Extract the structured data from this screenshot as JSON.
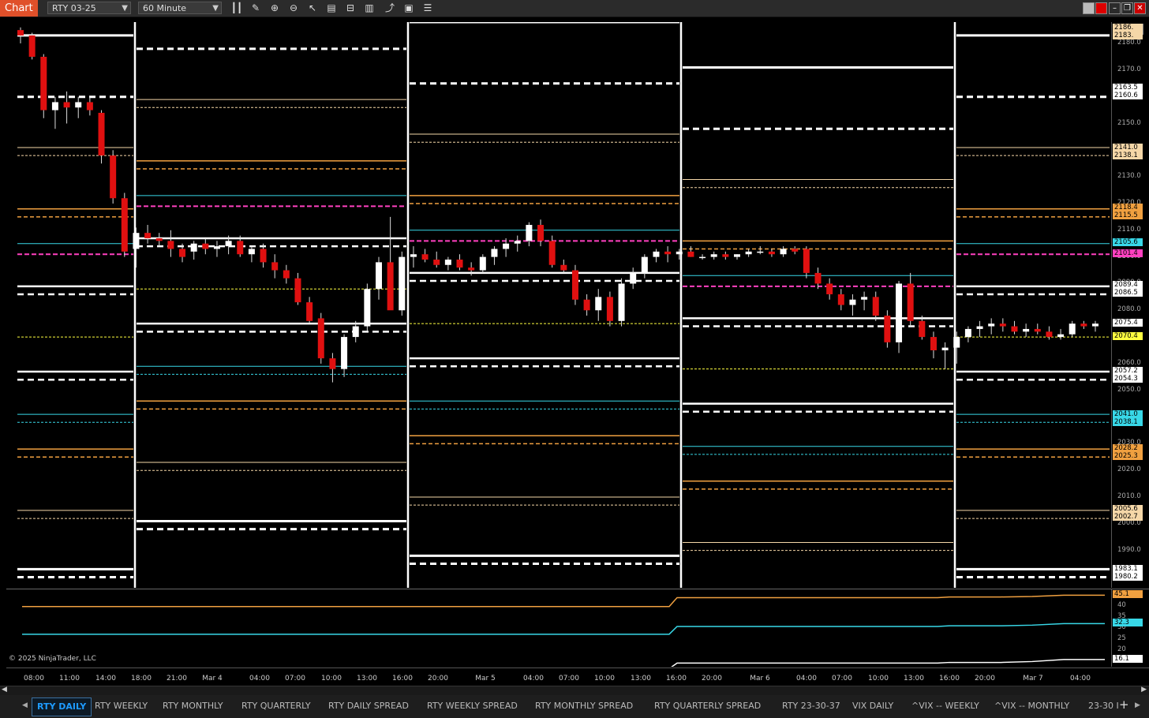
{
  "toolbar": {
    "chart_label": "Chart",
    "instrument": "RTY 03-25",
    "interval": "60 Minute"
  },
  "copyright": "© 2025 NinjaTrader, LLC",
  "price_ticks": [
    "2180.0",
    "2170.0",
    "2160.0",
    "2150.0",
    "2140.0",
    "2130.0",
    "2120.0",
    "2110.0",
    "2100.0",
    "2090.0",
    "2080.0",
    "2070.0",
    "2060.0",
    "2050.0",
    "2040.0",
    "2030.0",
    "2020.0",
    "2010.0",
    "2000.0",
    "1990.0",
    "1980.0"
  ],
  "price_tags": [
    {
      "label": "2186.",
      "color": "#f5d7a8",
      "price": 2186
    },
    {
      "label": "2183.",
      "color": "#f5d7a8",
      "price": 2183
    },
    {
      "label": "2163.5",
      "color": "#ffffff",
      "price": 2163.5
    },
    {
      "label": "2160.6",
      "color": "#ffffff",
      "price": 2160.6
    },
    {
      "label": "2141.0",
      "color": "#f5d7a8",
      "price": 2141
    },
    {
      "label": "2138.1",
      "color": "#f5d7a8",
      "price": 2138.1
    },
    {
      "label": "2118.4",
      "color": "#f0a040",
      "price": 2118.4
    },
    {
      "label": "2115.5",
      "color": "#f0a040",
      "price": 2115.5
    },
    {
      "label": "2105.6",
      "color": "#38d8e8",
      "price": 2105.6
    },
    {
      "label": "2101.4",
      "color": "#ff40c0",
      "price": 2101.4
    },
    {
      "label": "2089.4",
      "color": "#ffffff",
      "price": 2089.4
    },
    {
      "label": "2086.5",
      "color": "#ffffff",
      "price": 2086.5
    },
    {
      "label": "2075.4",
      "color": "#ffffff",
      "price": 2075.4
    },
    {
      "label": "2070.4",
      "color": "#ffff40",
      "price": 2070.4
    },
    {
      "label": "2057.2",
      "color": "#ffffff",
      "price": 2057.2
    },
    {
      "label": "2054.3",
      "color": "#ffffff",
      "price": 2054.3
    },
    {
      "label": "2041.0",
      "color": "#38d8e8",
      "price": 2041
    },
    {
      "label": "2038.1",
      "color": "#38d8e8",
      "price": 2038.1
    },
    {
      "label": "2028.2",
      "color": "#f0a040",
      "price": 2028.2
    },
    {
      "label": "2025.3",
      "color": "#f0a040",
      "price": 2025.3
    },
    {
      "label": "2005.6",
      "color": "#f5d7a8",
      "price": 2005.6
    },
    {
      "label": "2002.7",
      "color": "#f5d7a8",
      "price": 2002.7
    },
    {
      "label": "1983.1",
      "color": "#ffffff",
      "price": 1983.1
    },
    {
      "label": "1980.2",
      "color": "#ffffff",
      "price": 1980.2
    }
  ],
  "indicator": {
    "ticks": [
      "40",
      "35",
      "30",
      "25",
      "20"
    ],
    "tags": [
      {
        "label": "45.1",
        "color": "#f0a040",
        "value": 45.1
      },
      {
        "label": "32.3",
        "color": "#38d8e8",
        "value": 32.3
      },
      {
        "label": "16.1",
        "color": "#ffffff",
        "value": 16.1
      }
    ]
  },
  "time_ticks": [
    "08:00",
    "11:00",
    "14:00",
    "18:00",
    "21:00",
    "Mar 4",
    "04:00",
    "07:00",
    "10:00",
    "13:00",
    "16:00",
    "20:00",
    "Mar 5",
    "04:00",
    "07:00",
    "10:00",
    "13:00",
    "16:00",
    "20:00",
    "Mar 6",
    "04:00",
    "07:00",
    "10:00",
    "13:00",
    "16:00",
    "20:00",
    "Mar 7",
    "04:00"
  ],
  "tabs": [
    "RTY DAILY",
    "RTY WEEKLY",
    "RTY MONTHLY",
    "RTY QUARTERLY",
    "RTY DAILY SPREAD",
    "RTY WEEKLY SPREAD",
    "RTY MONTHLY SPREAD",
    "RTY QUARTERLY SPREAD",
    "RTY 23-30-37",
    "VIX DAILY",
    "^VIX -- WEEKLY",
    "^VIX -- MONTHLY",
    "23-30 I"
  ],
  "chart_data": {
    "type": "candlestick",
    "instrument": "RTY 03-25",
    "interval": "60 Minute",
    "ylim": [
      1976,
      2188
    ],
    "candles": [
      [
        2185,
        2186,
        2180,
        2183
      ],
      [
        2183,
        2184,
        2174,
        2175
      ],
      [
        2175,
        2176,
        2152,
        2155
      ],
      [
        2155,
        2160,
        2148,
        2158
      ],
      [
        2158,
        2162,
        2150,
        2156
      ],
      [
        2156,
        2160,
        2152,
        2158
      ],
      [
        2158,
        2160,
        2153,
        2155
      ],
      [
        2154,
        2155,
        2135,
        2138
      ],
      [
        2138,
        2140,
        2120,
        2122
      ],
      [
        2122,
        2124,
        2100,
        2102
      ],
      [
        2103,
        2111,
        2096,
        2109
      ],
      [
        2109,
        2112,
        2105,
        2107
      ],
      [
        2107,
        2109,
        2104,
        2106
      ],
      [
        2106,
        2110,
        2100,
        2103
      ],
      [
        2103,
        2105,
        2098,
        2100
      ],
      [
        2102,
        2106,
        2099,
        2105
      ],
      [
        2105,
        2107,
        2101,
        2103
      ],
      [
        2103,
        2106,
        2100,
        2104
      ],
      [
        2104,
        2108,
        2101,
        2106
      ],
      [
        2106,
        2108,
        2100,
        2101
      ],
      [
        2101,
        2104,
        2098,
        2103
      ],
      [
        2103,
        2105,
        2096,
        2098
      ],
      [
        2098,
        2101,
        2092,
        2095
      ],
      [
        2095,
        2097,
        2090,
        2092
      ],
      [
        2092,
        2094,
        2082,
        2083
      ],
      [
        2083,
        2085,
        2075,
        2076
      ],
      [
        2077,
        2079,
        2060,
        2062
      ],
      [
        2062,
        2064,
        2053,
        2058
      ],
      [
        2058,
        2071,
        2055,
        2070
      ],
      [
        2070,
        2076,
        2068,
        2074
      ],
      [
        2074,
        2090,
        2072,
        2088
      ],
      [
        2088,
        2100,
        2084,
        2098
      ],
      [
        2098,
        2115,
        2092,
        2080
      ],
      [
        2080,
        2102,
        2078,
        2100
      ],
      [
        2100,
        2104,
        2096,
        2101
      ],
      [
        2101,
        2103,
        2098,
        2099
      ],
      [
        2099,
        2102,
        2096,
        2097
      ],
      [
        2097,
        2100,
        2095,
        2099
      ],
      [
        2099,
        2101,
        2095,
        2096
      ],
      [
        2096,
        2098,
        2093,
        2095
      ],
      [
        2095,
        2101,
        2094,
        2100
      ],
      [
        2100,
        2104,
        2097,
        2103
      ],
      [
        2103,
        2107,
        2100,
        2105
      ],
      [
        2105,
        2108,
        2102,
        2106
      ],
      [
        2106,
        2113,
        2104,
        2112
      ],
      [
        2112,
        2114,
        2104,
        2106
      ],
      [
        2106,
        2108,
        2096,
        2097
      ],
      [
        2097,
        2099,
        2094,
        2095
      ],
      [
        2095,
        2097,
        2082,
        2084
      ],
      [
        2084,
        2086,
        2078,
        2080
      ],
      [
        2080,
        2088,
        2076,
        2085
      ],
      [
        2085,
        2087,
        2074,
        2076
      ],
      [
        2076,
        2092,
        2074,
        2090
      ],
      [
        2090,
        2096,
        2088,
        2094
      ],
      [
        2094,
        2101,
        2092,
        2100
      ],
      [
        2100,
        2103,
        2098,
        2102
      ],
      [
        2102,
        2104,
        2098,
        2101
      ],
      [
        2101,
        2103,
        2099,
        2102
      ],
      [
        2102,
        2104,
        2100,
        2100
      ],
      [
        2100,
        2101,
        2099,
        2100
      ],
      [
        2100,
        2102,
        2099,
        2101
      ],
      [
        2101,
        2102,
        2099,
        2100
      ],
      [
        2100,
        2101,
        2099,
        2101
      ],
      [
        2101,
        2103,
        2100,
        2102
      ],
      [
        2102,
        2104,
        2101,
        2102
      ],
      [
        2102,
        2103,
        2100,
        2101
      ],
      [
        2101,
        2104,
        2100,
        2103
      ],
      [
        2103,
        2104,
        2101,
        2102
      ],
      [
        2103,
        2104,
        2092,
        2094
      ],
      [
        2094,
        2096,
        2088,
        2090
      ],
      [
        2090,
        2092,
        2084,
        2086
      ],
      [
        2086,
        2088,
        2080,
        2082
      ],
      [
        2082,
        2086,
        2078,
        2084
      ],
      [
        2084,
        2087,
        2080,
        2085
      ],
      [
        2085,
        2087,
        2076,
        2078
      ],
      [
        2078,
        2080,
        2066,
        2068
      ],
      [
        2068,
        2091,
        2064,
        2090
      ],
      [
        2090,
        2094,
        2074,
        2076
      ],
      [
        2076,
        2078,
        2069,
        2070
      ],
      [
        2070,
        2072,
        2062,
        2065
      ],
      [
        2065,
        2068,
        2058,
        2066
      ],
      [
        2066,
        2072,
        2060,
        2070
      ],
      [
        2070,
        2074,
        2068,
        2073
      ],
      [
        2073,
        2076,
        2070,
        2074
      ],
      [
        2074,
        2077,
        2071,
        2075
      ],
      [
        2075,
        2077,
        2072,
        2074
      ],
      [
        2074,
        2076,
        2071,
        2072
      ],
      [
        2072,
        2075,
        2070,
        2073
      ],
      [
        2073,
        2075,
        2071,
        2072
      ],
      [
        2072,
        2074,
        2069,
        2070
      ],
      [
        2070,
        2073,
        2069,
        2071
      ],
      [
        2071,
        2076,
        2070,
        2075
      ],
      [
        2075,
        2076,
        2073,
        2074
      ],
      [
        2074,
        2076,
        2072,
        2075
      ]
    ],
    "indicator_series": [
      {
        "values": [
          40.0,
          40.0,
          40.0,
          40.0,
          44.0,
          44.0,
          44.3,
          44.3,
          44.5,
          45.1,
          45.1
        ]
      },
      {
        "values": [
          27.5,
          27.5,
          27.5,
          27.5,
          31.0,
          31.0,
          31.3,
          31.3,
          31.6,
          32.3,
          32.3
        ]
      },
      {
        "values": [
          12.0,
          12.0,
          12.0,
          12.0,
          14.5,
          14.5,
          14.8,
          14.8,
          15.2,
          16.1,
          16.1
        ]
      }
    ]
  }
}
